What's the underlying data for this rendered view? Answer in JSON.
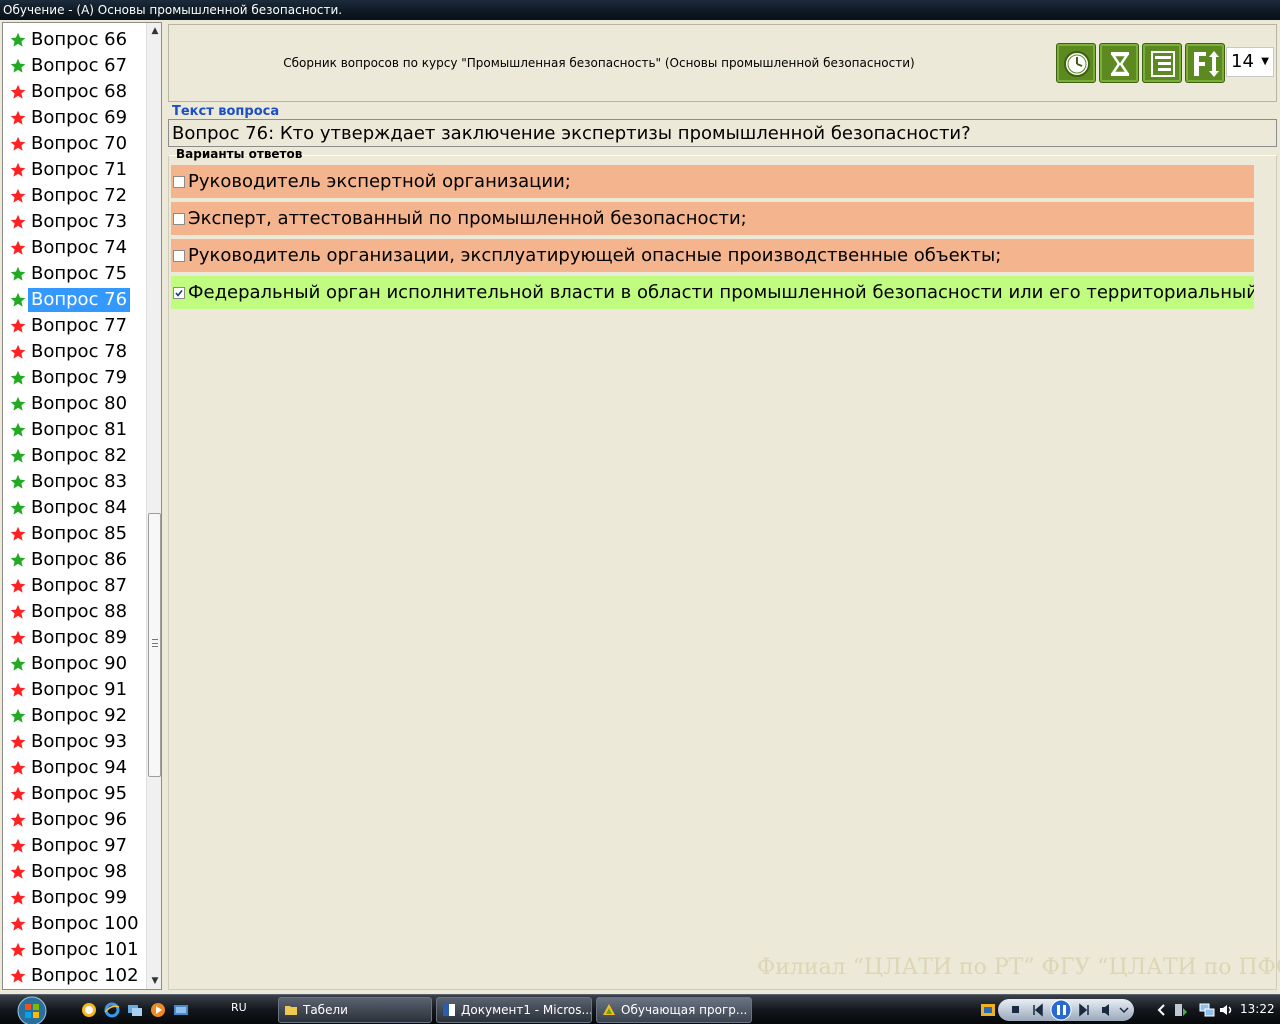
{
  "window": {
    "title": "Обучение - (А) Основы промышленной безопасности."
  },
  "colors": {
    "star_correct": "#22aa22",
    "star_wrong": "#ff2222",
    "answer_wrong": "#f4b48e",
    "answer_correct": "#c0fc80",
    "selection": "#3399ff",
    "section_label": "#1a4fc8"
  },
  "question_list": [
    {
      "label": "Вопрос 66",
      "status": "correct"
    },
    {
      "label": "Вопрос 67",
      "status": "correct"
    },
    {
      "label": "Вопрос 68",
      "status": "wrong"
    },
    {
      "label": "Вопрос 69",
      "status": "wrong"
    },
    {
      "label": "Вопрос 70",
      "status": "wrong"
    },
    {
      "label": "Вопрос 71",
      "status": "wrong"
    },
    {
      "label": "Вопрос 72",
      "status": "wrong"
    },
    {
      "label": "Вопрос 73",
      "status": "wrong"
    },
    {
      "label": "Вопрос 74",
      "status": "wrong"
    },
    {
      "label": "Вопрос 75",
      "status": "correct"
    },
    {
      "label": "Вопрос 76",
      "status": "correct",
      "selected": true
    },
    {
      "label": "Вопрос 77",
      "status": "wrong"
    },
    {
      "label": "Вопрос 78",
      "status": "wrong"
    },
    {
      "label": "Вопрос 79",
      "status": "correct"
    },
    {
      "label": "Вопрос 80",
      "status": "correct"
    },
    {
      "label": "Вопрос 81",
      "status": "correct"
    },
    {
      "label": "Вопрос 82",
      "status": "correct"
    },
    {
      "label": "Вопрос 83",
      "status": "correct"
    },
    {
      "label": "Вопрос 84",
      "status": "correct"
    },
    {
      "label": "Вопрос 85",
      "status": "wrong"
    },
    {
      "label": "Вопрос 86",
      "status": "correct"
    },
    {
      "label": "Вопрос 87",
      "status": "wrong"
    },
    {
      "label": "Вопрос 88",
      "status": "wrong"
    },
    {
      "label": "Вопрос 89",
      "status": "wrong"
    },
    {
      "label": "Вопрос 90",
      "status": "correct"
    },
    {
      "label": "Вопрос 91",
      "status": "wrong"
    },
    {
      "label": "Вопрос 92",
      "status": "correct"
    },
    {
      "label": "Вопрос 93",
      "status": "wrong"
    },
    {
      "label": "Вопрос 94",
      "status": "wrong"
    },
    {
      "label": "Вопрос 95",
      "status": "wrong"
    },
    {
      "label": "Вопрос 96",
      "status": "wrong"
    },
    {
      "label": "Вопрос 97",
      "status": "wrong"
    },
    {
      "label": "Вопрос 98",
      "status": "wrong"
    },
    {
      "label": "Вопрос 99",
      "status": "wrong"
    },
    {
      "label": "Вопрос 100",
      "status": "wrong"
    },
    {
      "label": "Вопрос 101",
      "status": "wrong"
    },
    {
      "label": "Вопрос 102",
      "status": "wrong"
    }
  ],
  "header": {
    "course_title": "Сборник вопросов по курсу \"Промышленная безопасность\" (Основы промышленной безопасности)",
    "buttons": [
      {
        "name": "timer-button",
        "icon": "clock-icon"
      },
      {
        "name": "hourglass-button",
        "icon": "hourglass-icon"
      },
      {
        "name": "list-button",
        "icon": "list-icon"
      },
      {
        "name": "font-size-button",
        "icon": "font-size-icon"
      }
    ],
    "font_size_value": "14"
  },
  "question": {
    "section_label": "Текст вопроса",
    "text": "Вопрос 76: Кто утверждает заключение экспертизы промышленной безопасности?"
  },
  "answers": {
    "section_label": "Варианты ответов",
    "items": [
      {
        "text": "Руководитель экспертной организации;",
        "checked": false,
        "correct": false
      },
      {
        "text": "Эксперт, аттестованный по промышленной безопасности;",
        "checked": false,
        "correct": false
      },
      {
        "text": "Руководитель организации, эксплуатирующей опасные производственные объекты;",
        "checked": false,
        "correct": false
      },
      {
        "text": "Федеральный орган исполнительной власти в области промышленной безопасности или его территориальный орган;",
        "checked": true,
        "correct": true
      }
    ]
  },
  "watermark": "Филиал “ЦЛАТИ по РТ” ФГУ “ЦЛАТИ по ПФО”",
  "taskbar": {
    "language": "RU",
    "tasks": [
      {
        "label": "Табели",
        "icon": "folder-icon"
      },
      {
        "label": "Документ1 - Micros...",
        "icon": "word-icon"
      },
      {
        "label": "Обучающая прогр...",
        "icon": "app-icon"
      }
    ],
    "clock": "13:22"
  }
}
